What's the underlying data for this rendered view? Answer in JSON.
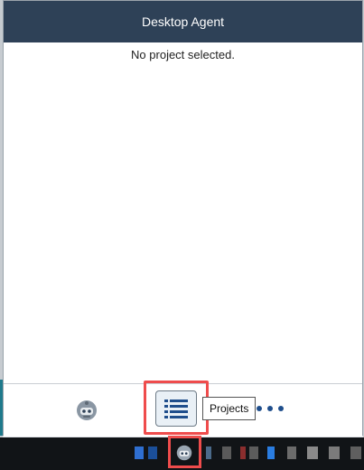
{
  "window": {
    "title": "Desktop Agent",
    "status_message": "No project selected."
  },
  "footer": {
    "robot_icon": "robot-icon",
    "list_icon": "list-icon",
    "projects_tooltip": "Projects",
    "more_icon": "more-horizontal-icon"
  },
  "taskbar": {
    "agent_tray_icon": "robot-icon"
  },
  "colors": {
    "titlebar": "#2e4157",
    "highlight": "#ef4c4c",
    "accent": "#1f4e8c"
  }
}
